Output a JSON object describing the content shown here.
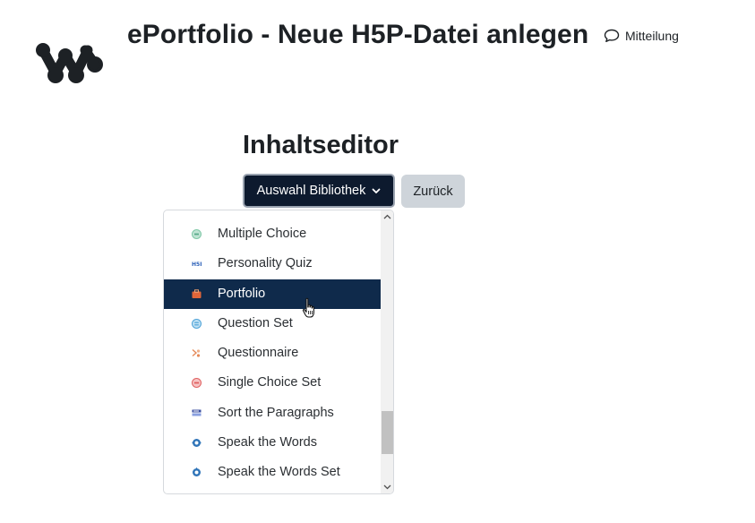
{
  "header": {
    "title": "ePortfolio - Neue H5P-Datei anlegen",
    "message_label": "Mitteilung",
    "logo_icon": "logo-icon",
    "message_icon": "speech-bubble-icon"
  },
  "editor": {
    "heading": "Inhaltseditor",
    "library_button_label": "Auswahl Bibliothek",
    "back_button_label": "Zurück"
  },
  "dropdown": {
    "items": [
      {
        "label": "Multiple Choice",
        "icon": "multiple-choice-icon",
        "color": "#7fc7a6"
      },
      {
        "label": "Personality Quiz",
        "icon": "h5p-icon",
        "color": "#2a5fb8"
      },
      {
        "label": "Portfolio",
        "icon": "portfolio-icon",
        "color": "#e0663a"
      },
      {
        "label": "Question Set",
        "icon": "question-set-icon",
        "color": "#4ea3d8"
      },
      {
        "label": "Questionnaire",
        "icon": "questionnaire-icon",
        "color": "#e58a5a"
      },
      {
        "label": "Single Choice Set",
        "icon": "single-choice-icon",
        "color": "#e06060"
      },
      {
        "label": "Sort the Paragraphs",
        "icon": "sort-paragraphs-icon",
        "color": "#3b4fa0"
      },
      {
        "label": "Speak the Words",
        "icon": "speak-words-icon",
        "color": "#2f74b8"
      },
      {
        "label": "Speak the Words Set",
        "icon": "speak-words-set-icon",
        "color": "#2f74b8"
      }
    ],
    "active_index": 2,
    "active_color": "#0f2a4b"
  },
  "colors": {
    "primary_button": "#0d1a2e",
    "secondary_button": "#ced4da",
    "text": "#1d2125"
  }
}
